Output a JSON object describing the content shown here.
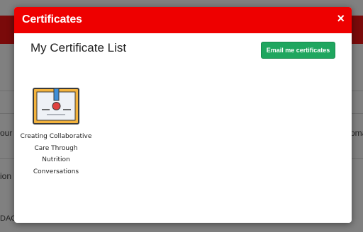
{
  "background": {
    "left_fragments": [
      "our",
      "ion",
      "DAC"
    ],
    "right_fragments": [
      "oma"
    ]
  },
  "modal": {
    "title": "Certificates",
    "close_label": "×",
    "list_title": "My Certificate List",
    "email_button_label": "Email me certificates",
    "certificates": [
      {
        "name": "Creating Collaborative\nCare Through\nNutrition\nConversations",
        "icon": "certificate-icon"
      }
    ]
  },
  "colors": {
    "header": "#ee0000",
    "email_button": "#1fa65f",
    "certificate_frame": "#f3b33d",
    "certificate_ribbon": "#3f8ed6",
    "certificate_seal": "#e0413f"
  }
}
